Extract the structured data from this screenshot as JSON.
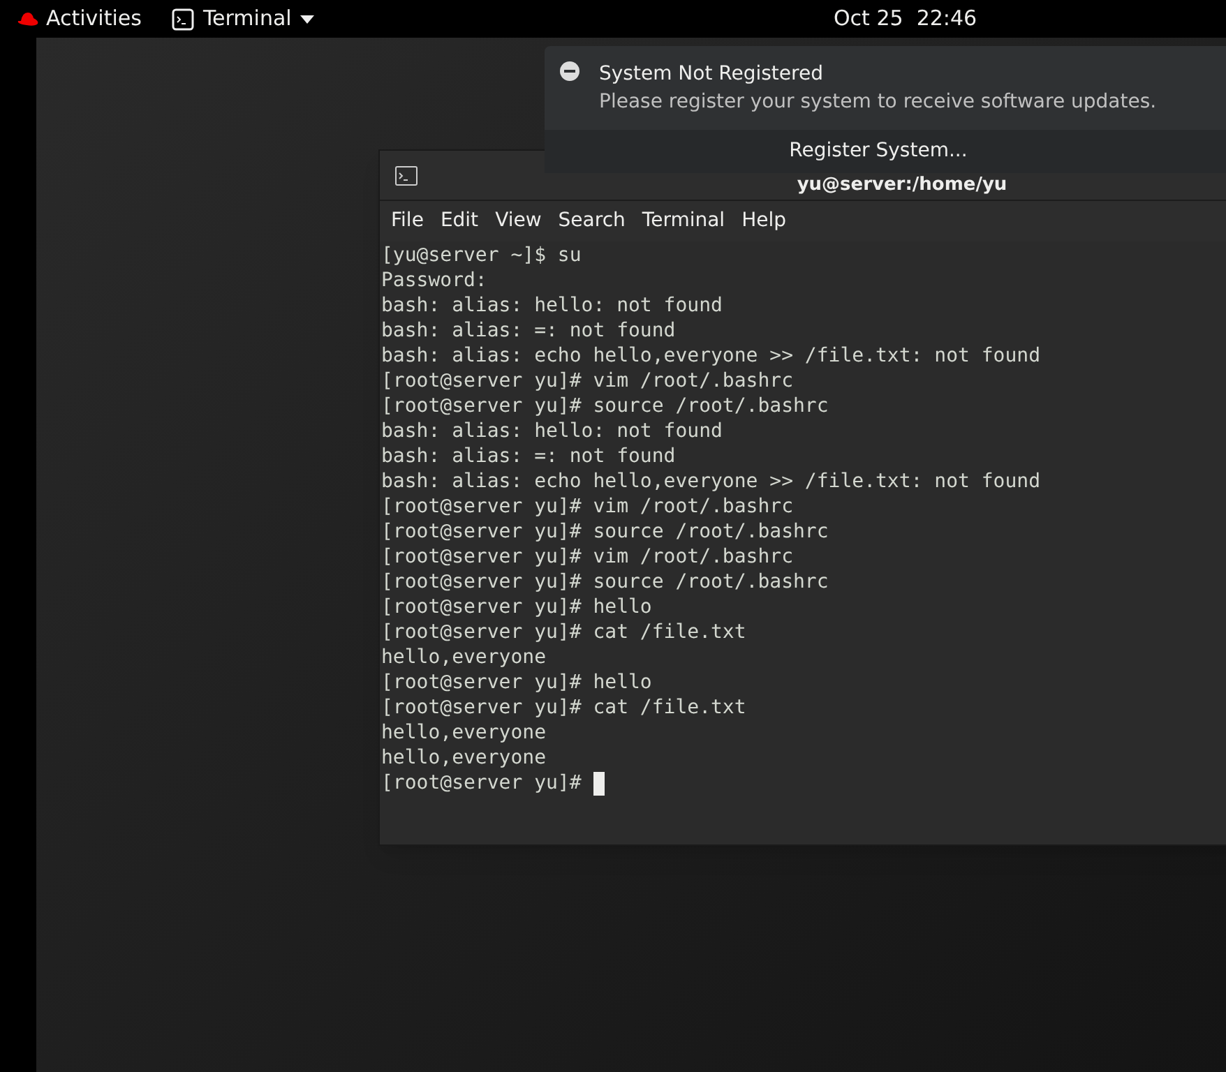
{
  "top_bar": {
    "activities": "Activities",
    "app_menu": "Terminal",
    "clock": "Oct 25  22:46"
  },
  "notification": {
    "title": "System Not Registered",
    "body": "Please register your system to receive software updates.",
    "action": "Register System..."
  },
  "terminal": {
    "title": "yu@server:/home/yu",
    "menu": [
      "File",
      "Edit",
      "View",
      "Search",
      "Terminal",
      "Help"
    ],
    "lines": [
      "[yu@server ~]$ su",
      "Password:",
      "bash: alias: hello: not found",
      "bash: alias: =: not found",
      "bash: alias: echo hello,everyone >> /file.txt: not found",
      "[root@server yu]# vim /root/.bashrc",
      "[root@server yu]# source /root/.bashrc",
      "bash: alias: hello: not found",
      "bash: alias: =: not found",
      "bash: alias: echo hello,everyone >> /file.txt: not found",
      "[root@server yu]# vim /root/.bashrc",
      "[root@server yu]# source /root/.bashrc",
      "[root@server yu]# vim /root/.bashrc",
      "[root@server yu]# source /root/.bashrc",
      "[root@server yu]# hello",
      "[root@server yu]# cat /file.txt",
      "hello,everyone",
      "[root@server yu]# hello",
      "[root@server yu]# cat /file.txt",
      "hello,everyone",
      "hello,everyone"
    ],
    "prompt": "[root@server yu]#"
  }
}
